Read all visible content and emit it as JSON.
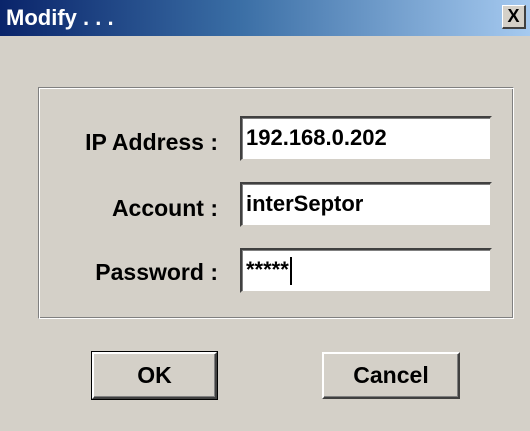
{
  "window": {
    "title": "Modify . . .",
    "close_label": "X"
  },
  "form": {
    "ip_label": "IP Address :",
    "ip_value": "192.168.0.202",
    "account_label": "Account :",
    "account_value": "interSeptor",
    "password_label": "Password :",
    "password_value": "*****"
  },
  "buttons": {
    "ok_label": "OK",
    "cancel_label": "Cancel"
  }
}
